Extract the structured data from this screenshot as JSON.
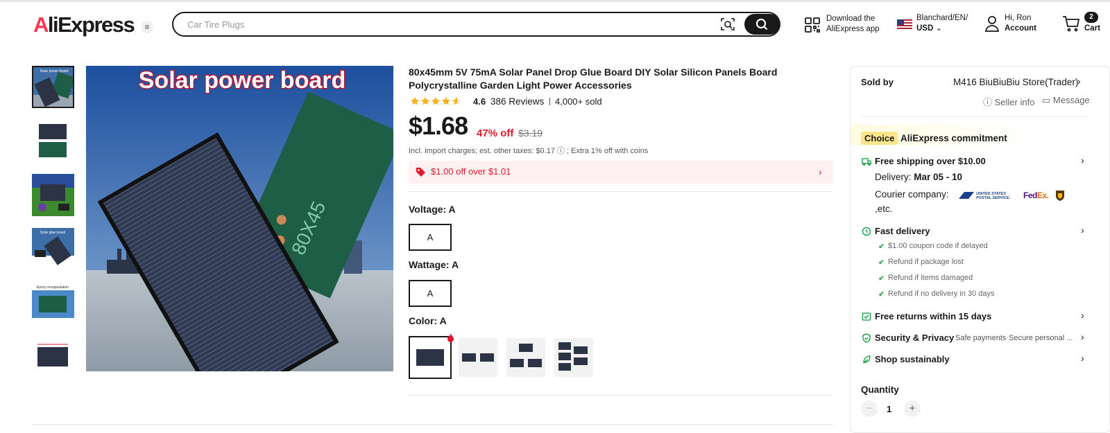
{
  "header": {
    "logo": "AliExpress",
    "search_placeholder": "Car Tire Plugs",
    "download_line1": "Download the",
    "download_line2": "AliExpress app",
    "lang_line1": "Blanchard/EN/",
    "lang_line2": "USD",
    "account_line1": "Hi, Ron",
    "account_line2": "Account",
    "cart_count": "2",
    "cart_label": "Cart"
  },
  "gallery": {
    "main_image_caption": "Solar power board",
    "main_image_marking": "80X45",
    "thumbs": [
      "Solar power board",
      "",
      "",
      "Solar glue board",
      "Epoxy encapsulation",
      ""
    ],
    "selected_index": 0
  },
  "product": {
    "title": "80x45mm 5V 75mA Solar Panel Drop Glue Board DIY Solar Silicon Panels Board Polycrystalline Garden Light Power Accessories",
    "rating": "4.6",
    "reviews": "386 Reviews",
    "sold": "4,000+ sold",
    "price": "$1.68",
    "discount": "47% off",
    "original_price": "$3.19",
    "taxes_note": "Incl. import charges; est. other taxes: $0.17 ⓘ ; Extra 1% off with coins",
    "coupon": "$1.00 off over $1.01",
    "voltage_label": "Voltage: A",
    "voltage_option": "A",
    "wattage_label": "Wattage: A",
    "wattage_option": "A",
    "color_label": "Color: A"
  },
  "seller": {
    "sold_by_label": "Sold by",
    "store_name": "M416 BiuBiuBiu Store(Trader)",
    "seller_info": "Seller info",
    "message": "Message"
  },
  "commitment": {
    "choice_badge": "Choice",
    "title": "AliExpress commitment",
    "free_shipping": "Free shipping over $10.00",
    "delivery_label": "Delivery:",
    "delivery_dates": "Mar 05 - 10",
    "courier_label": "Courier company:",
    "courier_etc": ",etc.",
    "carrier_usps": "UNITED STATES POSTAL SERVICE",
    "carrier_fedex": "FedEx.",
    "fast_delivery": "Fast delivery",
    "fast_items": [
      "$1.00 coupon code if delayed",
      "Refund if package lost",
      "Refund if items damaged",
      "Refund if no delivery in 30 days"
    ],
    "free_returns": "Free returns within 15 days",
    "security": "Security & Privacy",
    "security_note": "Safe payments·Secure personal ...",
    "sustainable": "Shop sustainably"
  },
  "quantity": {
    "label": "Quantity",
    "value": "1"
  },
  "colors": {
    "accent_red": "#e2192c",
    "choice_yellow": "#fde68a",
    "brand_red": "#fd384f"
  }
}
